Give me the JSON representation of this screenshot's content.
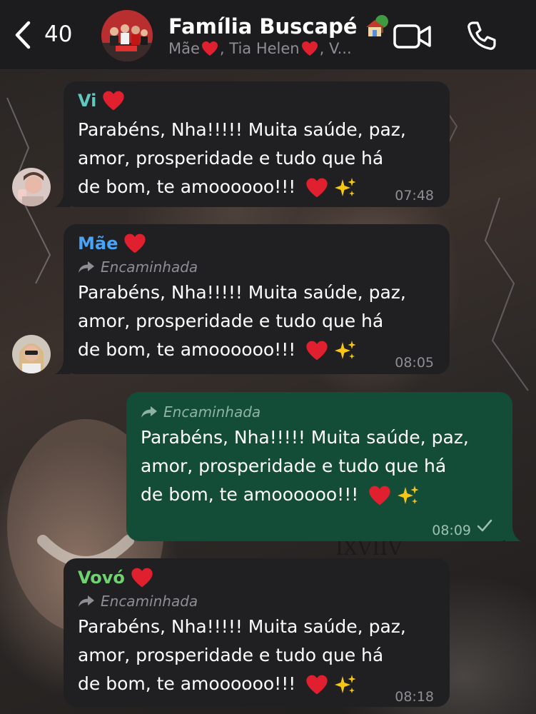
{
  "header": {
    "back_count": "40",
    "title": "Família Buscapé",
    "subtitle_parts": [
      "Mãe",
      ", Tia Helen",
      ", V..."
    ]
  },
  "messages": [
    {
      "sender": "Vi",
      "sender_color": "#5fc9c0",
      "forwarded": "",
      "text": "Parabéns, Nha!!!!! Muita saúde, paz,\namor, prosperidade e tudo que há\nde bom, te amoooooo!!!",
      "time": "07:48"
    },
    {
      "sender": "Mãe",
      "sender_color": "#4aa3f5",
      "forwarded": "Encaminhada",
      "text": "Parabéns, Nha!!!!! Muita saúde, paz,\namor, prosperidade e tudo que há\nde bom, te amoooooo!!!",
      "time": "08:05"
    },
    {
      "sender": "",
      "forwarded": "Encaminhada",
      "text": "Parabéns, Nha!!!!! Muita saúde, paz,\namor, prosperidade e tudo que há\nde bom, te amoooooo!!!",
      "time": "08:09"
    },
    {
      "sender": "Vovó",
      "sender_color": "#6fd36f",
      "forwarded": "Encaminhada",
      "text": "Parabéns, Nha!!!!! Muita saúde, paz,\namor, prosperidade e tudo que há\nde bom, te amoooooo!!!",
      "time": "08:18"
    }
  ],
  "icons": {
    "back": "chevron-left-icon",
    "video": "video-camera-icon",
    "call": "phone-icon",
    "forward": "forward-arrow-icon",
    "read": "checkmark-icon"
  },
  "colors": {
    "header_bg": "#1c1c1e",
    "incoming_bubble": "#202022",
    "outgoing_bubble": "#144d37",
    "heart": "#e0202f"
  }
}
